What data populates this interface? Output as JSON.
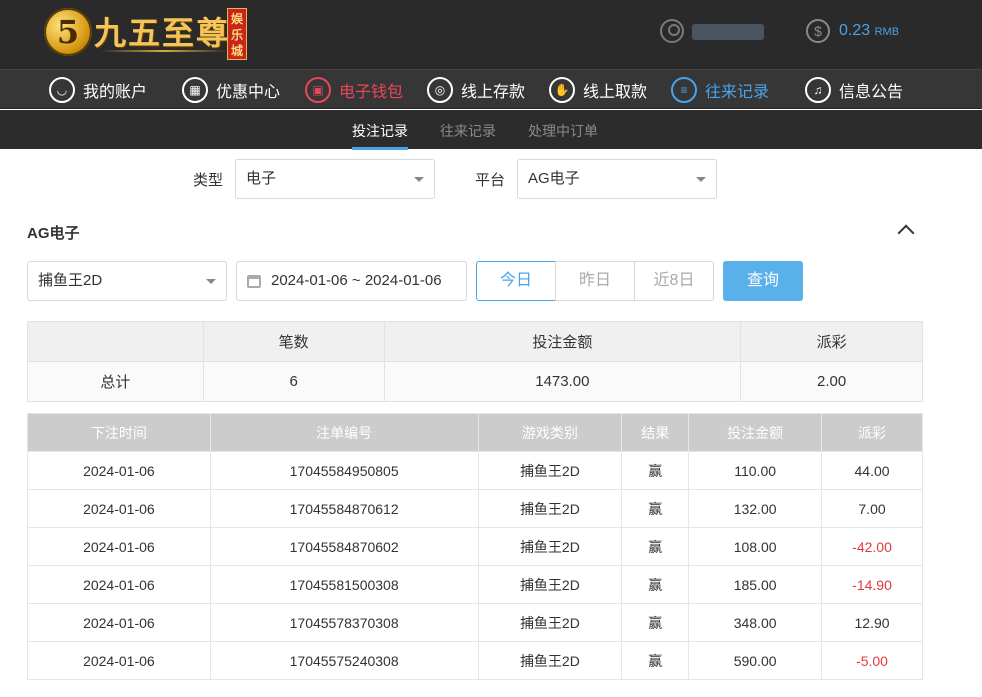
{
  "logo": {
    "mark": "5",
    "name": "九五至尊",
    "seal": "娱乐城"
  },
  "balance": {
    "amount": "0.23",
    "unit": "RMB"
  },
  "nav": [
    {
      "label": "我的账户",
      "icon": "user-icon"
    },
    {
      "label": "优惠中心",
      "icon": "gift-icon"
    },
    {
      "label": "电子钱包",
      "icon": "wallet-icon"
    },
    {
      "label": "线上存款",
      "icon": "deposit-icon"
    },
    {
      "label": "线上取款",
      "icon": "withdraw-icon"
    },
    {
      "label": "往来记录",
      "icon": "records-icon"
    },
    {
      "label": "信息公告",
      "icon": "bell-icon"
    }
  ],
  "subnav": [
    {
      "label": "投注记录",
      "active": true
    },
    {
      "label": "往来记录",
      "active": false
    },
    {
      "label": "处理中订单",
      "active": false
    }
  ],
  "filters": {
    "type_label": "类型",
    "type_value": "电子",
    "platform_label": "平台",
    "platform_value": "AG电子"
  },
  "section": {
    "title": "AG电子"
  },
  "query": {
    "game": "捕鱼王2D",
    "date_range": "2024-01-06 ~ 2024-01-06",
    "today": "今日",
    "yesterday": "昨日",
    "last8": "近8日",
    "submit": "查询"
  },
  "summary": {
    "headers": [
      "",
      "笔数",
      "投注金额",
      "派彩"
    ],
    "row": [
      "总计",
      "6",
      "1473.00",
      "2.00"
    ]
  },
  "detail": {
    "headers": [
      "下注时间",
      "注单编号",
      "游戏类别",
      "结果",
      "投注金额",
      "派彩"
    ],
    "rows": [
      [
        "2024-01-06",
        "17045584950805",
        "捕鱼王2D",
        "赢",
        "110.00",
        "44.00"
      ],
      [
        "2024-01-06",
        "17045584870612",
        "捕鱼王2D",
        "赢",
        "132.00",
        "7.00"
      ],
      [
        "2024-01-06",
        "17045584870602",
        "捕鱼王2D",
        "赢",
        "108.00",
        "-42.00"
      ],
      [
        "2024-01-06",
        "17045581500308",
        "捕鱼王2D",
        "赢",
        "185.00",
        "-14.90"
      ],
      [
        "2024-01-06",
        "17045578370308",
        "捕鱼王2D",
        "赢",
        "348.00",
        "12.90"
      ],
      [
        "2024-01-06",
        "17045575240308",
        "捕鱼王2D",
        "赢",
        "590.00",
        "-5.00"
      ]
    ]
  },
  "colors": {
    "accent": "#4aa3e8",
    "wallet": "#e8475a",
    "negative": "#e23b3b"
  }
}
